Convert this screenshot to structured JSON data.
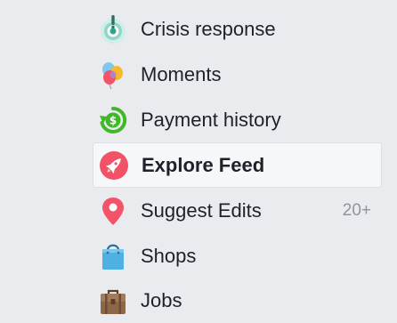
{
  "menu": {
    "items": [
      {
        "label": "Crisis response",
        "icon": "crisis-response-icon"
      },
      {
        "label": "Moments",
        "icon": "balloons-icon"
      },
      {
        "label": "Payment history",
        "icon": "payment-history-icon"
      },
      {
        "label": "Explore Feed",
        "icon": "rocket-icon",
        "selected": true
      },
      {
        "label": "Suggest Edits",
        "icon": "map-pin-icon",
        "badge": "20+"
      },
      {
        "label": "Shops",
        "icon": "shopping-bag-icon"
      },
      {
        "label": "Jobs",
        "icon": "briefcase-icon"
      }
    ]
  },
  "colors": {
    "background": "#e9ebee",
    "selected_background": "#f6f7f9",
    "text": "#1d2129",
    "badge_text": "#90949c",
    "rocket_red": "#f25268",
    "pin_red": "#f35369",
    "payment_green": "#42b72a",
    "crisis_teal": "#2fa48f",
    "shops_blue": "#4fb0e3",
    "jobs_brown": "#8d6748"
  }
}
